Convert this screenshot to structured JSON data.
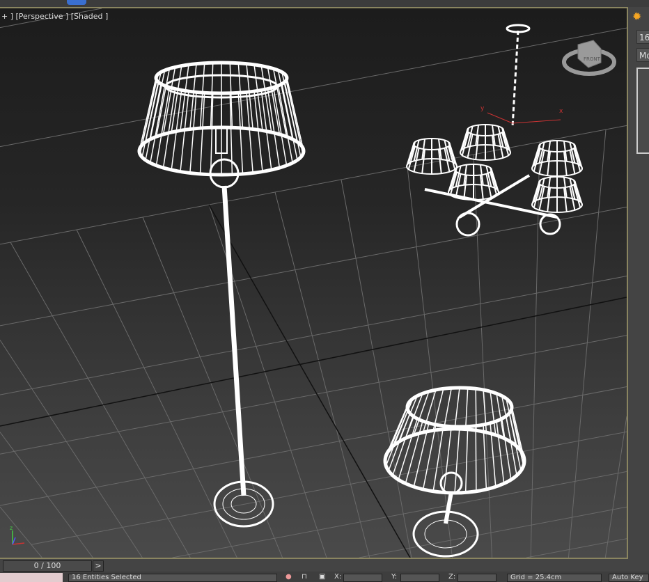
{
  "viewport": {
    "label": "+ ] [Perspective ] [Shaded ]",
    "viewcube_label": "FRONT",
    "axis_labels": {
      "x": "x",
      "y": "y",
      "z": "z"
    }
  },
  "command_panel": {
    "field1": "16",
    "field2": "Mo"
  },
  "timeline": {
    "frame": "0 / 100",
    "next": ">"
  },
  "status_bar": {
    "selection": "16 Entities Selected",
    "x_label": "X:",
    "y_label": "Y:",
    "z_label": "Z:",
    "x": "",
    "y": "",
    "z": "",
    "grid": "Grid = 25.4cm",
    "auto_key": "Auto Key"
  }
}
